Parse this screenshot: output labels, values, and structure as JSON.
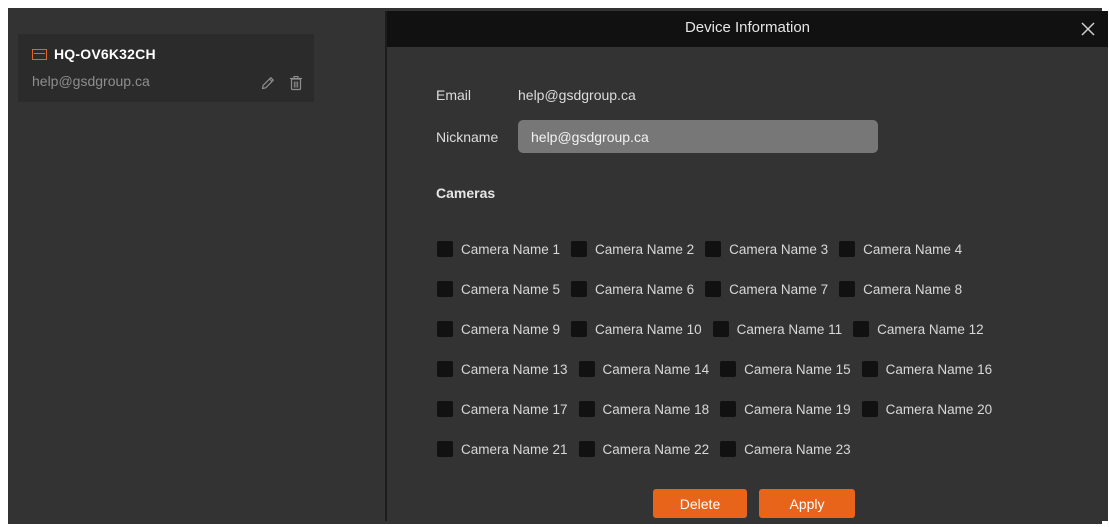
{
  "device": {
    "name": "HQ-OV6K32CH",
    "email": "help@gsdgroup.ca"
  },
  "dialog": {
    "title": "Device Information",
    "email_label": "Email",
    "email_value": "help@gsdgroup.ca",
    "nickname_label": "Nickname",
    "nickname_value": "help@gsdgroup.ca",
    "cameras_label": "Cameras",
    "camera_rows": [
      [
        "Camera Name 1",
        "Camera Name 2",
        "Camera Name 3",
        "Camera Name 4"
      ],
      [
        "Camera Name 5",
        "Camera Name 6",
        "Camera Name 7",
        "Camera Name 8"
      ],
      [
        "Camera Name 9",
        "Camera Name 10",
        "Camera Name 11",
        "Camera Name 12"
      ],
      [
        "Camera Name 13",
        "Camera Name 14",
        "Camera Name 15",
        "Camera Name 16"
      ],
      [
        "Camera Name 17",
        "Camera Name 18",
        "Camera Name 19",
        "Camera Name 20"
      ],
      [
        "Camera Name 21",
        "Camera Name 22",
        "Camera Name 23"
      ]
    ],
    "delete_label": "Delete",
    "apply_label": "Apply"
  },
  "icons": {
    "device": "device-icon",
    "edit": "pencil-icon",
    "delete": "trash-icon",
    "close": "close-icon"
  },
  "colors": {
    "accent": "#e8641b",
    "background": "#333333",
    "header": "#111111",
    "input": "#777777"
  }
}
